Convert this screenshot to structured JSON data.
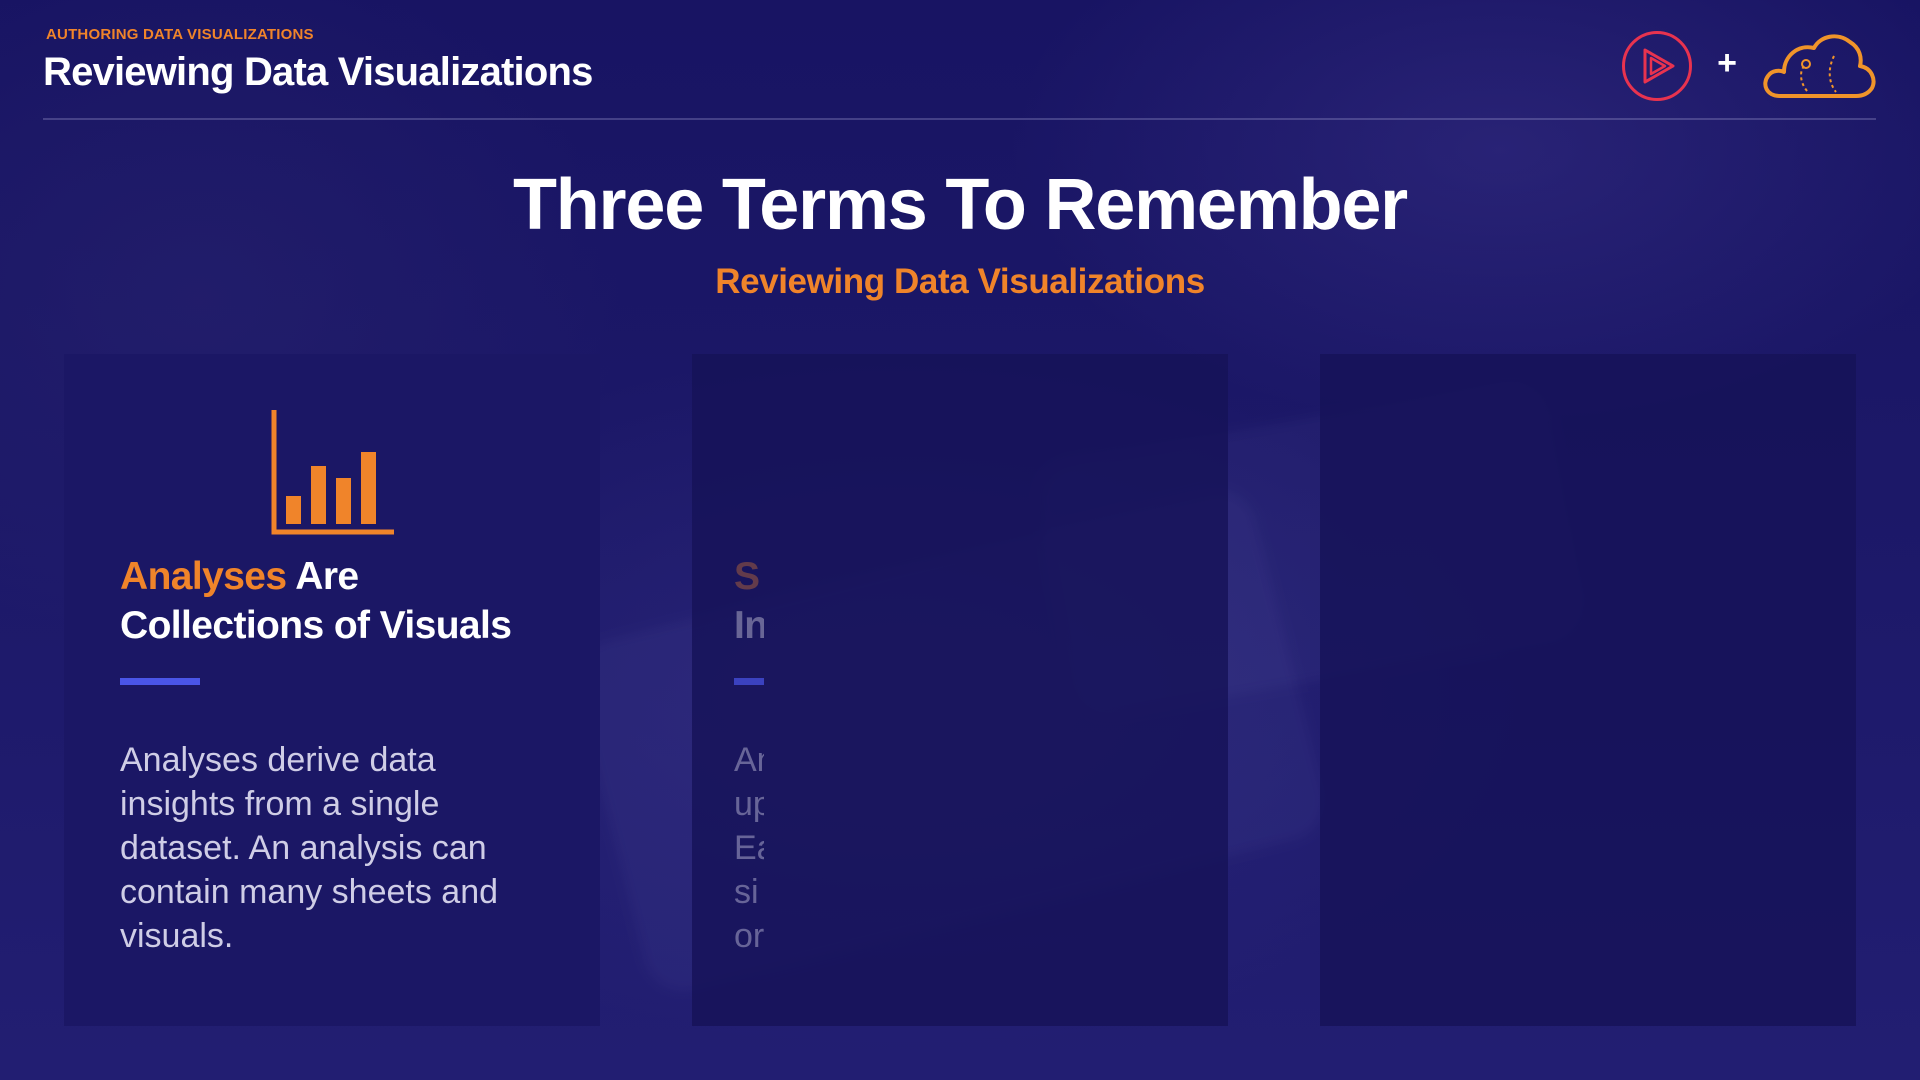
{
  "header": {
    "kicker": "AUTHORING DATA VISUALIZATIONS",
    "title": "Reviewing Data Visualizations"
  },
  "logos": {
    "play_icon": "play-logo-icon",
    "plus": "+",
    "cloud_icon": "cloud-logo-icon"
  },
  "slide": {
    "title": "Three Terms To Remember",
    "subtitle": "Reviewing Data Visualizations"
  },
  "cards": [
    {
      "icon": "bar-chart-icon",
      "heading_accent": "Analyses",
      "heading_rest": " Are",
      "heading_line2": "Collections of Visuals",
      "body": "Analyses derive data insights from a single dataset. An analysis can contain many sheets and visuals."
    },
    {
      "partial_head_1": "S",
      "partial_head_2": "In",
      "partial_body": [
        "An",
        "up",
        "Ea",
        "si",
        "or"
      ]
    },
    {}
  ],
  "colors": {
    "accent_orange": "#f0842a",
    "accent_blue": "#4a55e8",
    "accent_red": "#e8334f",
    "background": "#181463"
  }
}
